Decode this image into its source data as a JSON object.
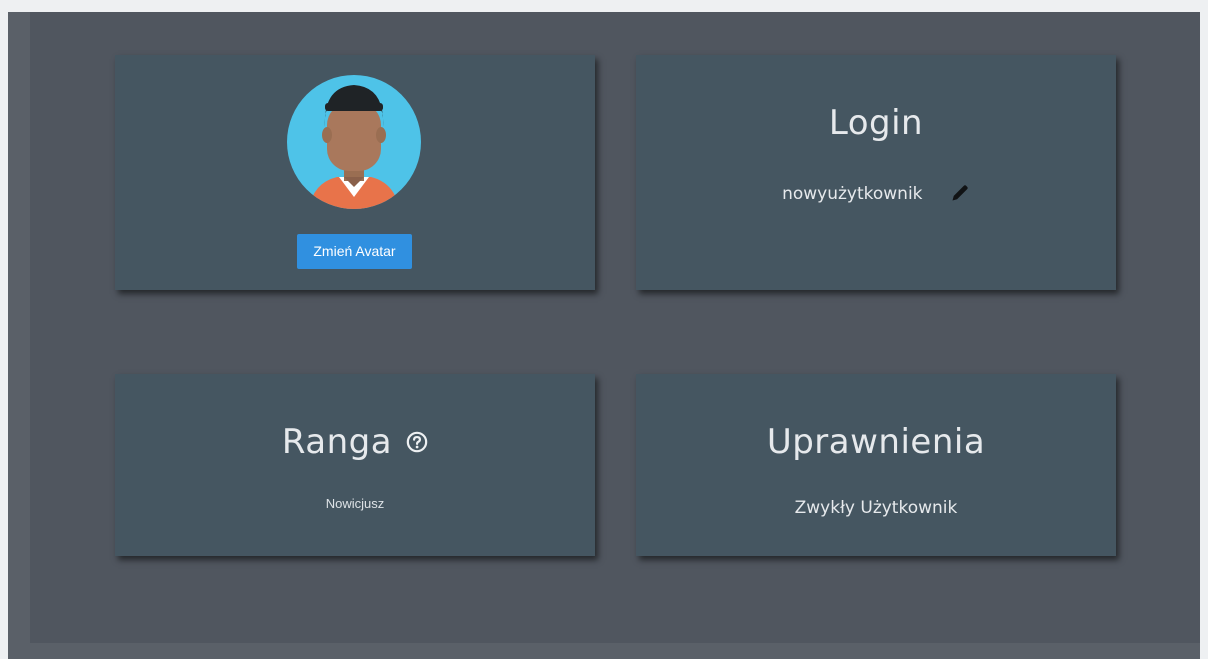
{
  "avatar_card": {
    "avatar_icon": "user-avatar-icon",
    "change_avatar_label": "Zmień Avatar",
    "button_color": "#3090e0"
  },
  "login_card": {
    "title": "Login",
    "username": "nowyużytkownik",
    "edit_icon": "pencil-icon"
  },
  "rank_card": {
    "title": "Ranga",
    "help_icon": "question-circle-icon",
    "value": "Nowicjusz"
  },
  "permissions_card": {
    "title": "Uprawnienia",
    "value": "Zwykły Użytkownik"
  },
  "colors": {
    "page_bg": "#50565f",
    "card_bg": "#455661",
    "text": "#e6e9ec"
  }
}
